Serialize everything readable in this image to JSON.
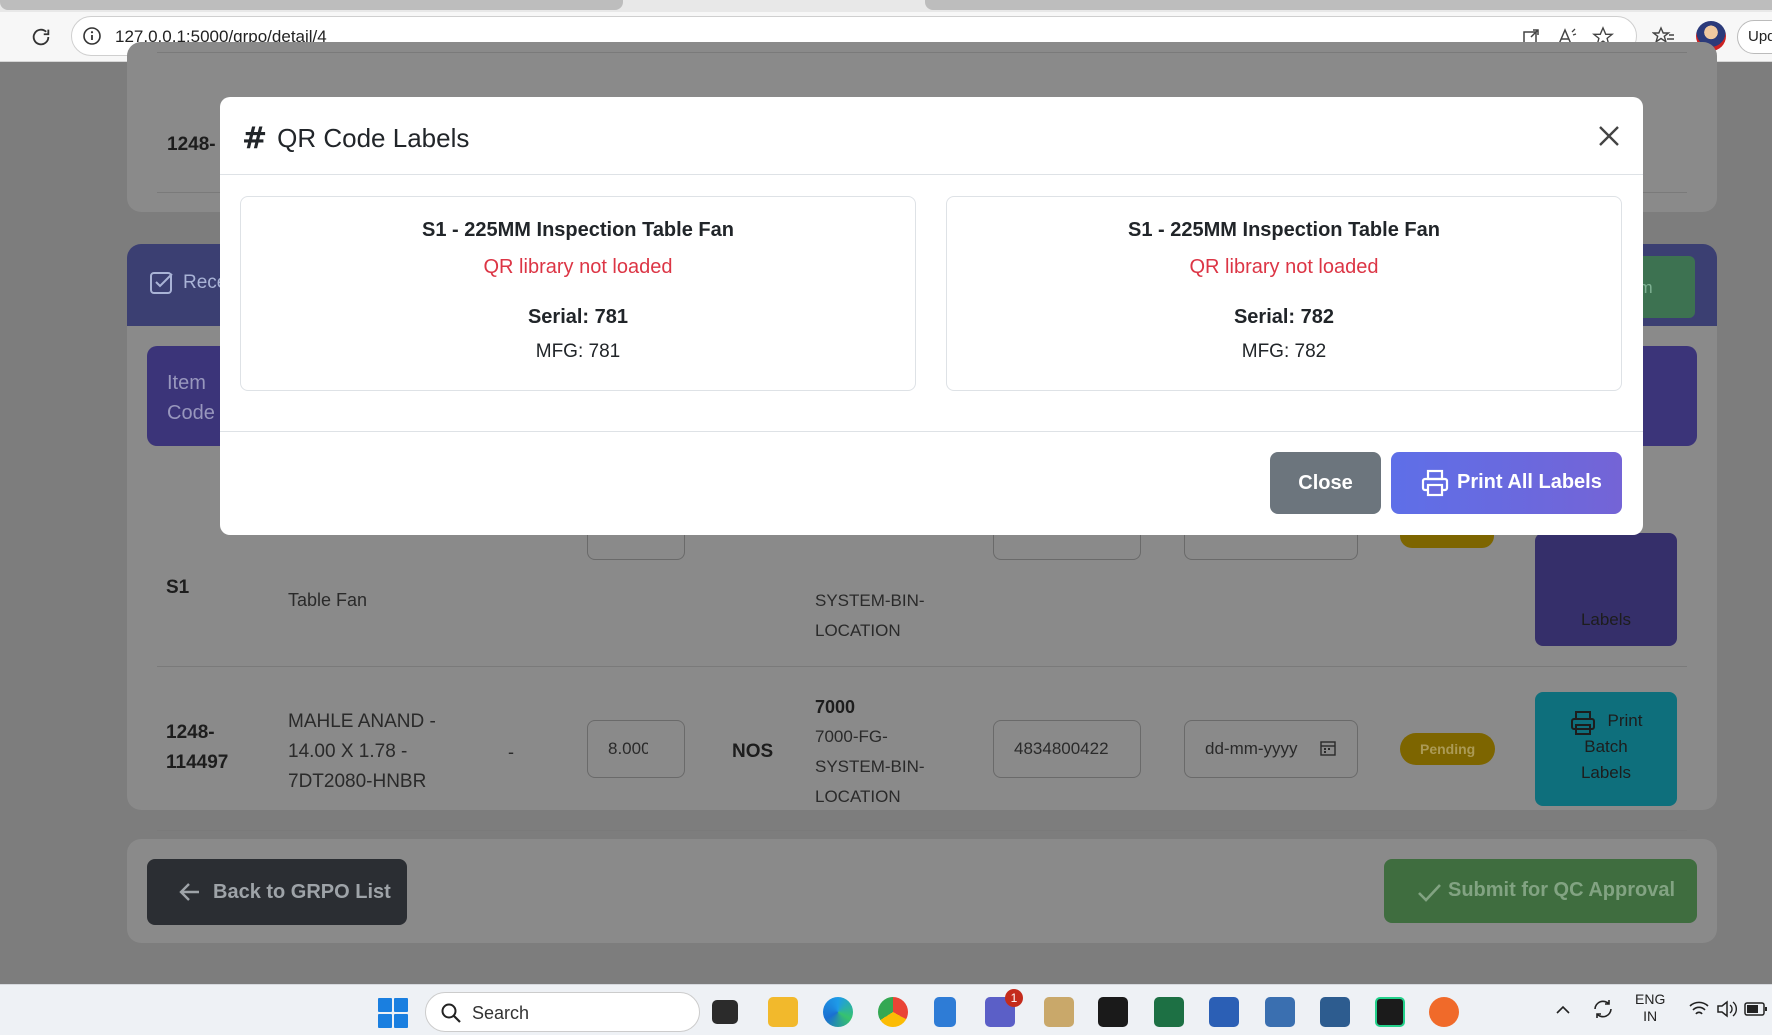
{
  "browser": {
    "url": "127.0.0.1:5000/grpo/detail/4",
    "profile_button": "Upd"
  },
  "page": {
    "top_row_code": "1248-",
    "section_title": "Rece",
    "section_button": "em",
    "table_header": "Item Code",
    "rows": [
      {
        "code": "S1",
        "description": "Table Fan",
        "warehouse_line1": "SYSTEM-BIN-",
        "warehouse_line2": "LOCATION",
        "print_label": "Labels"
      },
      {
        "code_line1": "1248-",
        "code_line2": "114497",
        "desc_line1": "MAHLE ANAND -",
        "desc_line2": "14.00 X 1.78 -",
        "desc_line3": "7DT2080-HNBR",
        "dash": "-",
        "quantity": "8.000",
        "uom": "NOS",
        "warehouse_code": "7000",
        "warehouse_line1": "7000-FG-",
        "warehouse_line2": "SYSTEM-BIN-",
        "warehouse_line3": "LOCATION",
        "batch": "4834800422",
        "date_placeholder": "dd-mm-yyyy",
        "status": "Pending",
        "print_line1": "Print",
        "print_line2": "Batch",
        "print_line3": "Labels"
      }
    ],
    "back_button": "Back to GRPO List",
    "submit_button": "Submit for QC Approval"
  },
  "modal": {
    "title": "QR Code Labels",
    "labels": [
      {
        "name": "S1 - 225MM Inspection Table Fan",
        "qr_status": "QR library not loaded",
        "serial": "Serial: 781",
        "mfg": "MFG: 781"
      },
      {
        "name": "S1 - 225MM Inspection Table Fan",
        "qr_status": "QR library not loaded",
        "serial": "Serial: 782",
        "mfg": "MFG: 782"
      }
    ],
    "close_button": "Close",
    "print_all_button": "Print All Labels"
  },
  "taskbar": {
    "search": "Search",
    "language_line1": "ENG",
    "language_line2": "IN",
    "teams_badge": "1"
  },
  "colors": {
    "primary": "#6c63e0",
    "danger": "#dc3545",
    "secondary": "#6c757d"
  }
}
